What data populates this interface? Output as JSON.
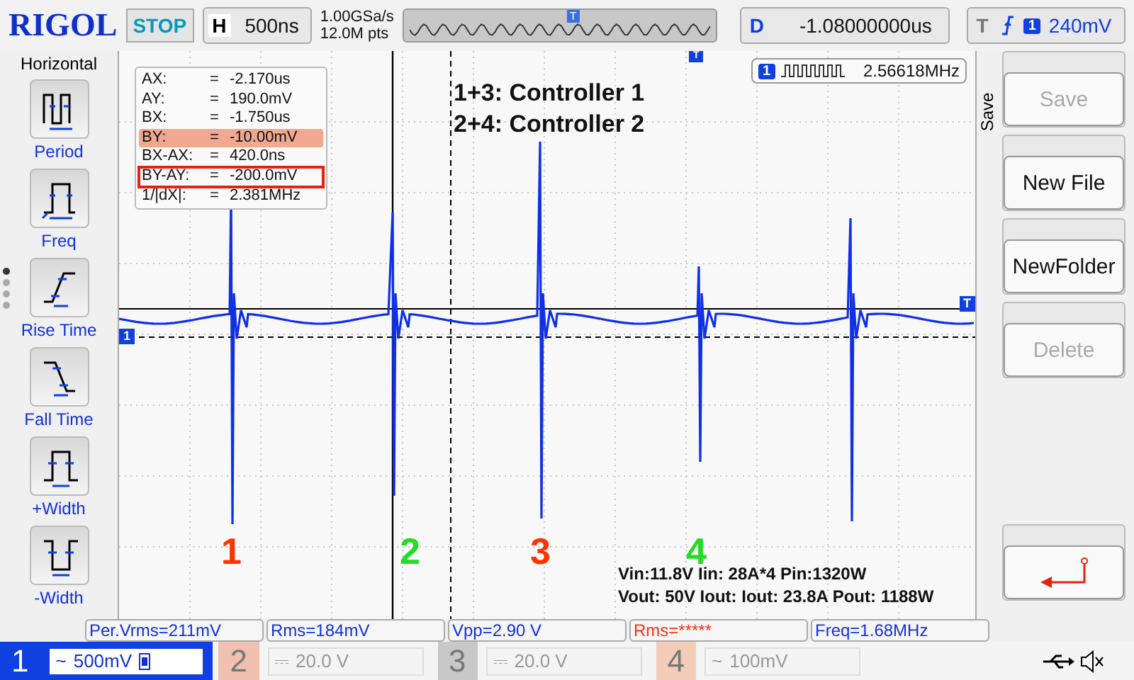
{
  "header": {
    "logo": "RIGOL",
    "run_state": "STOP",
    "horizontal": {
      "label": "H",
      "value": "500ns"
    },
    "sample_rate": "1.00GSa/s",
    "memory_depth": "12.0M pts",
    "overview_marker": "T",
    "delay": {
      "label": "D",
      "value": "-1.08000000us"
    },
    "trigger": {
      "label": "T",
      "channel": "1",
      "level": "240mV"
    }
  },
  "left_menu": {
    "title": "Horizontal",
    "page_dots": [
      {
        "selected": true
      },
      {
        "selected": false
      },
      {
        "selected": false
      },
      {
        "selected": false
      }
    ],
    "items": [
      {
        "kind": "period",
        "label": "Period"
      },
      {
        "kind": "freq",
        "label": "Freq"
      },
      {
        "kind": "rise",
        "label": "Rise Time"
      },
      {
        "kind": "fall",
        "label": "Fall Time"
      },
      {
        "kind": "pwidth",
        "label": "+Width"
      },
      {
        "kind": "nwidth",
        "label": "-Width"
      }
    ]
  },
  "screen": {
    "channel_marker": "1",
    "trigger_marker": "T",
    "top_trigger_marker": "T",
    "cursor_readout": [
      {
        "label": "AX:",
        "sep": "=",
        "value": "-2.170us",
        "highlighted": false,
        "boxed": false
      },
      {
        "label": "AY:",
        "sep": "=",
        "value": "190.0mV",
        "highlighted": false,
        "boxed": false
      },
      {
        "label": "BX:",
        "sep": "=",
        "value": "-1.750us",
        "highlighted": false,
        "boxed": false
      },
      {
        "label": "BY:",
        "sep": "=",
        "value": "-10.00mV",
        "highlighted": true,
        "boxed": false
      },
      {
        "label": "BX-AX:",
        "sep": "=",
        "value": "420.0ns",
        "highlighted": false,
        "boxed": false
      },
      {
        "label": "BY-AY:",
        "sep": "=",
        "value": "-200.0mV",
        "highlighted": false,
        "boxed": true
      },
      {
        "label": "1/|dX|:",
        "sep": "=",
        "value": "2.381MHz",
        "highlighted": false,
        "boxed": false
      }
    ],
    "frequency_counter": {
      "channel": "1",
      "value": "2.56618MHz"
    },
    "annotations": [
      "1+3: Controller 1",
      "2+4: Controller 2"
    ],
    "pulse_labels": [
      {
        "text": "1",
        "color": "#ff3300"
      },
      {
        "text": "2",
        "color": "#22dd22"
      },
      {
        "text": "3",
        "color": "#ff3300"
      },
      {
        "text": "4",
        "color": "#22dd22"
      }
    ],
    "power_summary": [
      "Vin:11.8V Iin: 28A*4 Pin:1320W",
      "Vout: 50V Iout: Iout: 23.8A Pout: 1188W"
    ]
  },
  "side_menu": {
    "title": "Save",
    "buttons": [
      {
        "kind": "text",
        "label": "Save",
        "disabled": true
      },
      {
        "kind": "text",
        "label": "New File",
        "disabled": false
      },
      {
        "kind": "text",
        "label": "NewFolder",
        "disabled": false
      },
      {
        "kind": "text",
        "label": "Delete",
        "disabled": true
      },
      {
        "kind": "back"
      }
    ]
  },
  "measurements": [
    {
      "text": "Per.Vrms=211mV",
      "invalid": false
    },
    {
      "text": "Rms=184mV",
      "invalid": false
    },
    {
      "text": "Vpp=2.90 V",
      "invalid": false
    },
    {
      "text": "Rms=*****",
      "invalid": true
    },
    {
      "text": "Freq=1.68MHz",
      "invalid": false
    }
  ],
  "channels": [
    {
      "number": "1",
      "coupling": "~",
      "scale": "500mV",
      "active": true,
      "color": "#1040e0"
    },
    {
      "number": "2",
      "coupling": "⎓",
      "scale": "20.0 V",
      "active": false,
      "color": "#f0c0b0"
    },
    {
      "number": "3",
      "coupling": "⎓",
      "scale": "20.0 V",
      "active": false,
      "color": "#c8c8c8"
    },
    {
      "number": "4",
      "coupling": "~",
      "scale": "100mV",
      "active": false,
      "color": "#f4cdb8"
    }
  ]
}
